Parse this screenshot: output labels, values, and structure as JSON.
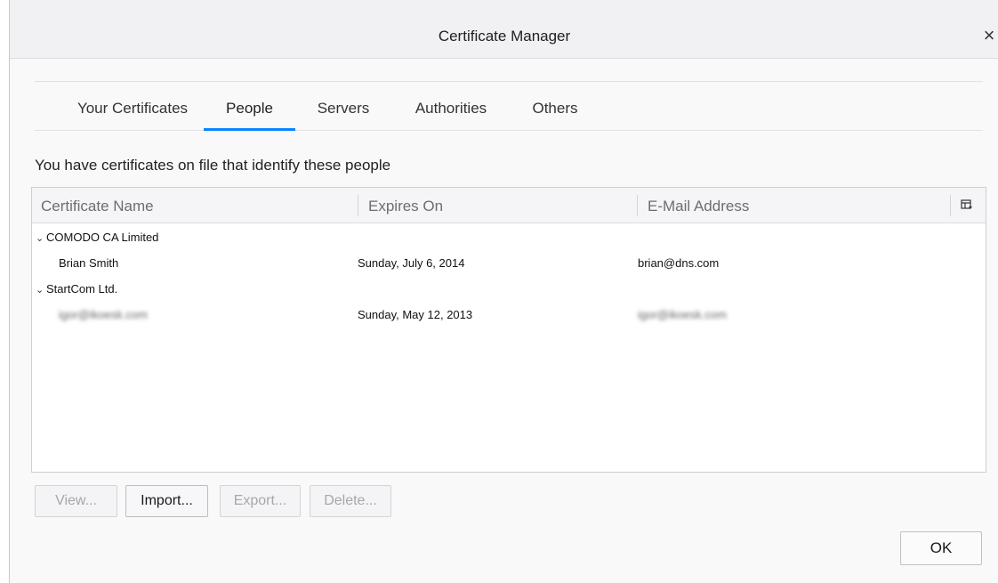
{
  "window": {
    "title": "Certificate Manager",
    "close_glyph": "×"
  },
  "tabs": [
    {
      "label": "Your Certificates",
      "active": false
    },
    {
      "label": "People",
      "active": true
    },
    {
      "label": "Servers",
      "active": false
    },
    {
      "label": "Authorities",
      "active": false
    },
    {
      "label": "Others",
      "active": false
    }
  ],
  "description": "You have certificates on file that identify these people",
  "table": {
    "columns": [
      "Certificate Name",
      "Expires On",
      "E-Mail Address"
    ],
    "column_picker_icon": "column-picker-icon",
    "groups": [
      {
        "name": "COMODO CA Limited",
        "expanded": true,
        "rows": [
          {
            "name": "Brian Smith",
            "expires": "Sunday, July 6, 2014",
            "email": "brian@dns.com",
            "redacted": false
          }
        ]
      },
      {
        "name": "StartCom Ltd.",
        "expanded": true,
        "rows": [
          {
            "name": "igor@ikoesk.com",
            "expires": "Sunday, May 12, 2013",
            "email": "igor@ikoesk.com",
            "redacted": true
          }
        ]
      }
    ]
  },
  "buttons": {
    "view": "View...",
    "import": "Import...",
    "export": "Export...",
    "delete": "Delete...",
    "ok": "OK"
  },
  "colors": {
    "accent": "#0a84ff"
  }
}
